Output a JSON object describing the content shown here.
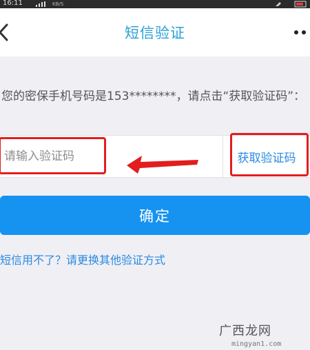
{
  "status_bar": {
    "time": "16:11",
    "speed": "KB/S"
  },
  "header": {
    "title": "短信验证"
  },
  "hint": {
    "text": "您的密保手机号码是153********，请点击“获取验证码”："
  },
  "form": {
    "code_placeholder": "请输入验证码",
    "get_code_label": "获取验证码",
    "confirm_label": "确定"
  },
  "alt_link": "短信用不了？请更换其他验证方式",
  "watermark": {
    "logo": "广西龙网",
    "url": "mingyan1.com"
  },
  "colors": {
    "accent": "#1692f0",
    "title": "#2aa0d6",
    "highlight": "#e21d1d"
  }
}
